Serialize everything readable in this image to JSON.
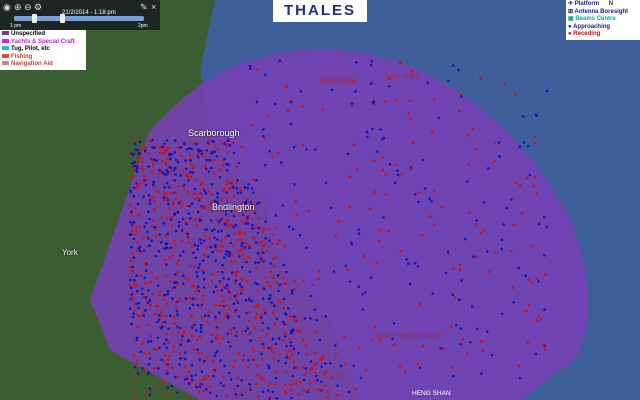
{
  "toolbar": {
    "time": "21/2/2014 - 1:18 pm",
    "start": "1 pm",
    "end": "2pm"
  },
  "logo": "THALES",
  "legend_left": [
    {
      "label": "Unspecified",
      "color": "#6a3b8a"
    },
    {
      "label": "Yachts & Special Craft",
      "color": "#e020e0"
    },
    {
      "label": "Tug, Pilot, etc",
      "color": "#20c0c0"
    },
    {
      "label": "Fishing",
      "color": "#e05030"
    },
    {
      "label": "Navigation Aid",
      "color": "#e08080"
    }
  ],
  "legend_right": [
    {
      "label": "Platform",
      "icon": "platform-icon"
    },
    {
      "label": "Antenna Boresight",
      "icon": "boresight-icon"
    },
    {
      "label": "Beams Centre",
      "icon": "beam-centre-icon"
    },
    {
      "label": "Approaching",
      "color": "#1010c0"
    },
    {
      "label": "Receding",
      "color": "#d01010"
    }
  ],
  "compass": "N",
  "places": [
    {
      "name": "Scarborough"
    },
    {
      "name": "Bridlington"
    },
    {
      "name": "York"
    }
  ],
  "vessel_names": [
    "BESTOONE",
    "LISA TAMA",
    "MATTERHORN SPIRIT",
    "HENG SHAN"
  ],
  "colors": {
    "coverage": "#7a3fb8",
    "sea": "#3f5f9a",
    "land": "#3a5a30",
    "approaching": "#1010c0",
    "receding": "#d01010"
  }
}
